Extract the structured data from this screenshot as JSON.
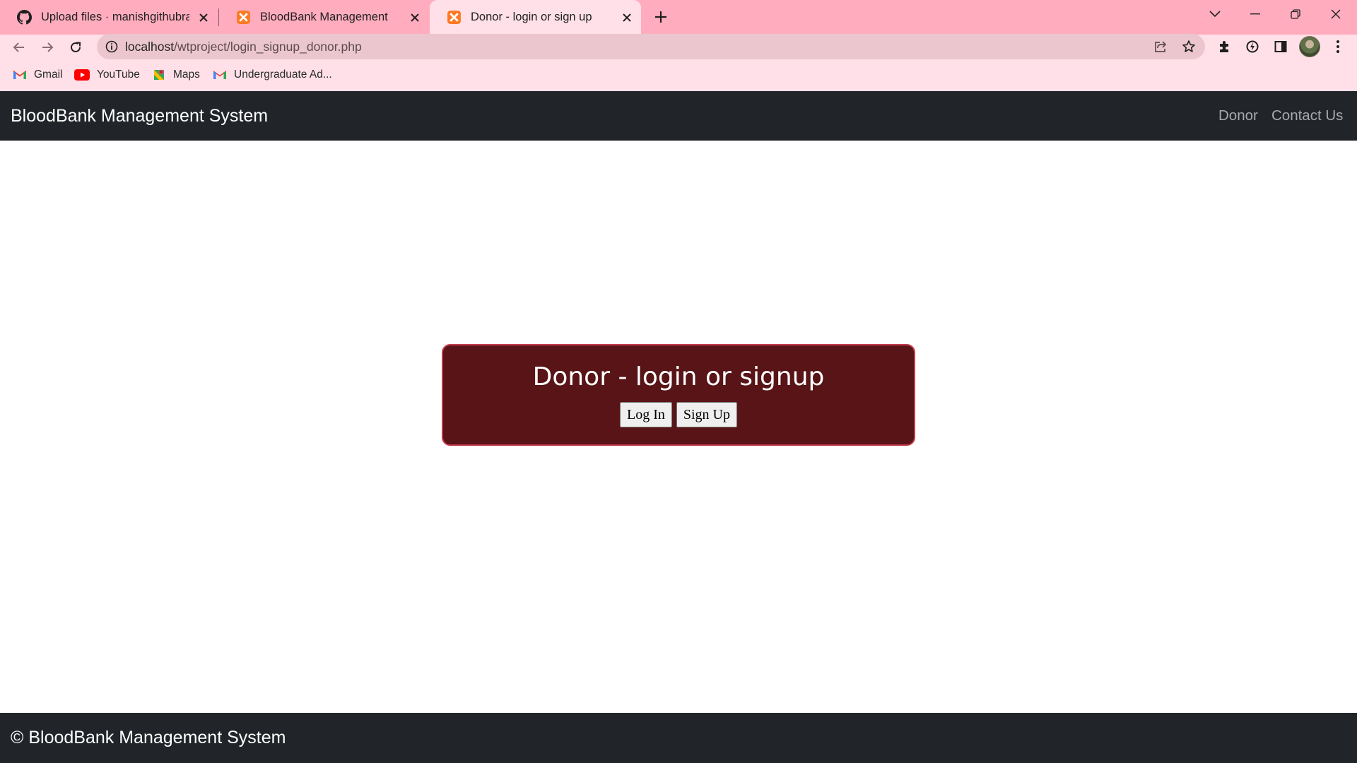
{
  "browser": {
    "tabs": [
      {
        "title": "Upload files · manishgithubraj/Bl",
        "favicon": "github-icon",
        "active": false
      },
      {
        "title": "BloodBank Management",
        "favicon": "xampp-icon",
        "active": false
      },
      {
        "title": "Donor - login or sign up",
        "favicon": "xampp-icon",
        "active": true
      }
    ],
    "address": {
      "host": "localhost",
      "path": "/wtproject/login_signup_donor.php"
    },
    "bookmarks": [
      {
        "label": "Gmail",
        "icon": "gmail-icon"
      },
      {
        "label": "YouTube",
        "icon": "youtube-icon"
      },
      {
        "label": "Maps",
        "icon": "maps-icon"
      },
      {
        "label": "Undergraduate Ad...",
        "icon": "gmail-icon"
      }
    ],
    "theme": {
      "tab_strip": "#ffadbe",
      "toolbar": "#ffe0e8",
      "omnibox": "#ebc6cf"
    }
  },
  "site": {
    "brand": "BloodBank Management System",
    "nav_links": [
      "Donor",
      "Contact Us"
    ],
    "card": {
      "title": "Donor - login or signup",
      "login_label": "Log In",
      "signup_label": "Sign Up"
    },
    "footer": "© BloodBank Management System",
    "colors": {
      "navbar": "#212529",
      "card_bg": "#581417",
      "card_border": "#c3394b"
    }
  }
}
